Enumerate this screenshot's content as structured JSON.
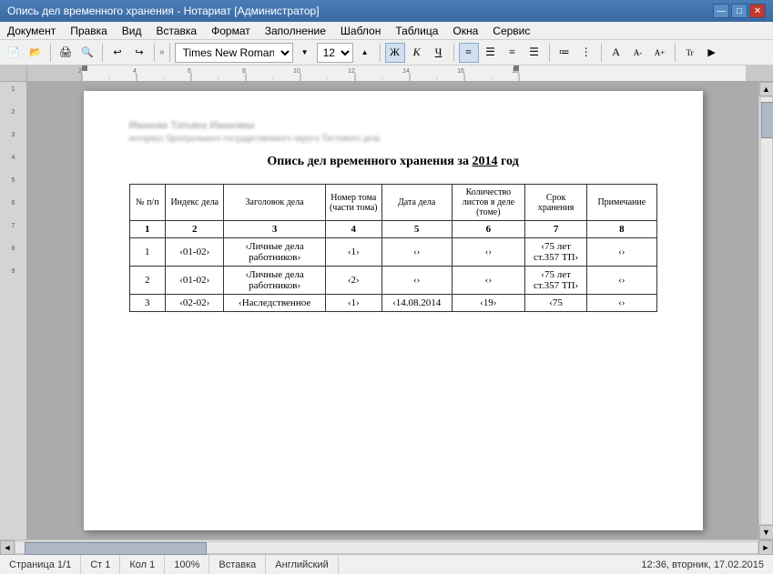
{
  "titleBar": {
    "title": "Опись дел временного хранения - Нотариат [Администратор]",
    "buttons": [
      "—",
      "□",
      "✕"
    ]
  },
  "menuBar": {
    "items": [
      "Документ",
      "Правка",
      "Вид",
      "Вставка",
      "Формат",
      "Заполнение",
      "Шаблон",
      "Таблица",
      "Окна",
      "Сервис"
    ]
  },
  "toolbar": {
    "font": "Times New Roman",
    "fontSize": "12",
    "boldLabel": "Ж",
    "italicLabel": "К",
    "underlineLabel": "Ч"
  },
  "document": {
    "blurredLine1": "Иванова Татьяна Ивановна",
    "blurredLine2": "нотариус Центрального государственного округа Тестового дела",
    "title": "Опись дел временного хранения за ",
    "year": "2014",
    "yearSuffix": " год"
  },
  "table": {
    "headers": [
      "№ п/п",
      "Индекс дела",
      "Заголовок дела",
      "Номер тома (части тома)",
      "Дата дела",
      "Количество листов в деле (томе)",
      "Срок хранения",
      "Примечание"
    ],
    "columnNumbers": [
      "1",
      "2",
      "3",
      "4",
      "5",
      "6",
      "7",
      "8"
    ],
    "rows": [
      {
        "num": "1",
        "index": "‹01-02›",
        "header": "‹Личные дела работников›",
        "tomno": "‹1›",
        "date": "‹›",
        "sheets": "‹›",
        "storage": "‹75 лет ст.357 ТП›",
        "notes": "‹›"
      },
      {
        "num": "2",
        "index": "‹01-02›",
        "header": "‹Личные дела работников›",
        "tomno": "‹2›",
        "date": "‹›",
        "sheets": "‹›",
        "storage": "‹75 лет ст.357 ТП›",
        "notes": "‹›"
      },
      {
        "num": "3",
        "index": "‹02-02›",
        "header": "‹Наследственное",
        "tomno": "‹1›",
        "date": "‹14.08.2014",
        "sheets": "‹19›",
        "storage": "‹75",
        "notes": "‹›"
      }
    ]
  },
  "statusBar": {
    "page": "Страница 1/1",
    "st": "Ст 1",
    "col": "Кол 1",
    "zoom": "100%",
    "mode": "Вставка",
    "lang": "Английский",
    "time": "12:36, вторник, 17.02.2015"
  }
}
